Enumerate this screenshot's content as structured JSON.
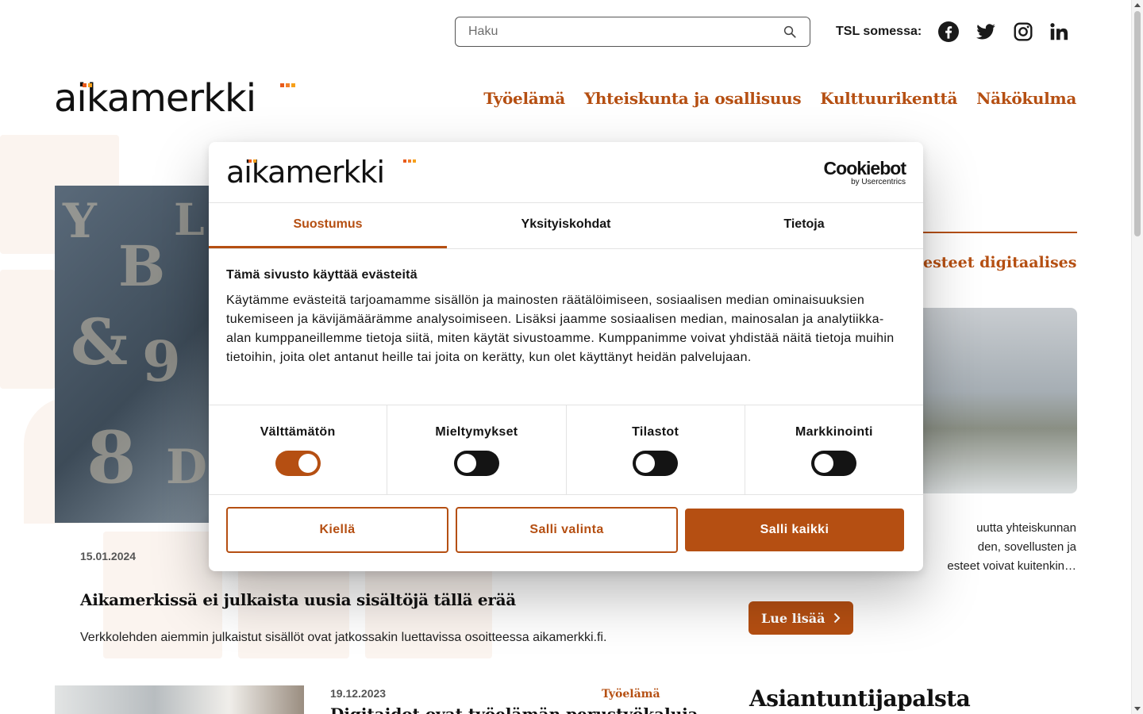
{
  "topbar": {
    "search_placeholder": "Haku",
    "social_label": "TSL somessa:",
    "social_icons": [
      "facebook-icon",
      "twitter-icon",
      "instagram-icon",
      "linkedin-icon"
    ]
  },
  "header": {
    "logo_text": "aikamerkki",
    "nav": [
      "Työelämä",
      "Yhteiskunta ja osallisuus",
      "Kulttuurikenttä",
      "Näkökulma"
    ]
  },
  "featured_article": {
    "date": "15.01.2024",
    "title": "Aikamerkissä ei julkaista uusia sisältöjä tällä erää",
    "description": "Verkkolehden aiemmin julkaistut sisällöt ovat jatkossakin luettavissa osoitteessa aikamerkki.fi."
  },
  "side_article": {
    "title_fragment": "esteet digitaalisessa",
    "desc_lines": [
      "uutta yhteiskunnan",
      "den, sovellusten ja",
      "esteet voivat kuitenkin…"
    ],
    "read_more": "Lue lisää"
  },
  "second_article": {
    "date": "19.12.2023",
    "category": "Työelämä",
    "title_fragment": "Digitaidot ovat työelämän perustyökaluja"
  },
  "sidebar": {
    "heading": "Asiantuntijapalsta"
  },
  "cookie_dialog": {
    "logo_text": "aikamerkki",
    "provider_name": "Cookiebot",
    "provider_sub": "by Usercentrics",
    "tabs": [
      "Suostumus",
      "Yksityiskohdat",
      "Tietoja"
    ],
    "active_tab": "Suostumus",
    "heading": "Tämä sivusto käyttää evästeitä",
    "body": "Käytämme evästeitä tarjoamamme sisällön ja mainosten räätälöimiseen, sosiaalisen median ominaisuuksien tukemiseen ja kävijämäärämme analysoimiseen. Lisäksi jaamme sosiaalisen median, mainosalan ja analytiikka-alan kumppaneillemme tietoja siitä, miten käytät sivustoamme. Kumppanimme voivat yhdistää näitä tietoja muihin tietoihin, joita olet antanut heille tai joita on kerätty, kun olet käyttänyt heidän palvelujaan.",
    "toggles": [
      {
        "label": "Välttämätön",
        "state": "on"
      },
      {
        "label": "Mieltymykset",
        "state": "off"
      },
      {
        "label": "Tilastot",
        "state": "off"
      },
      {
        "label": "Markkinointi",
        "state": "off"
      }
    ],
    "buttons": {
      "deny": "Kiellä",
      "allow_selection": "Salli valinta",
      "allow_all": "Salli kaikki"
    }
  },
  "colors": {
    "accent": "#b54f12",
    "dark": "#141414",
    "toggle_off": "#141414"
  }
}
